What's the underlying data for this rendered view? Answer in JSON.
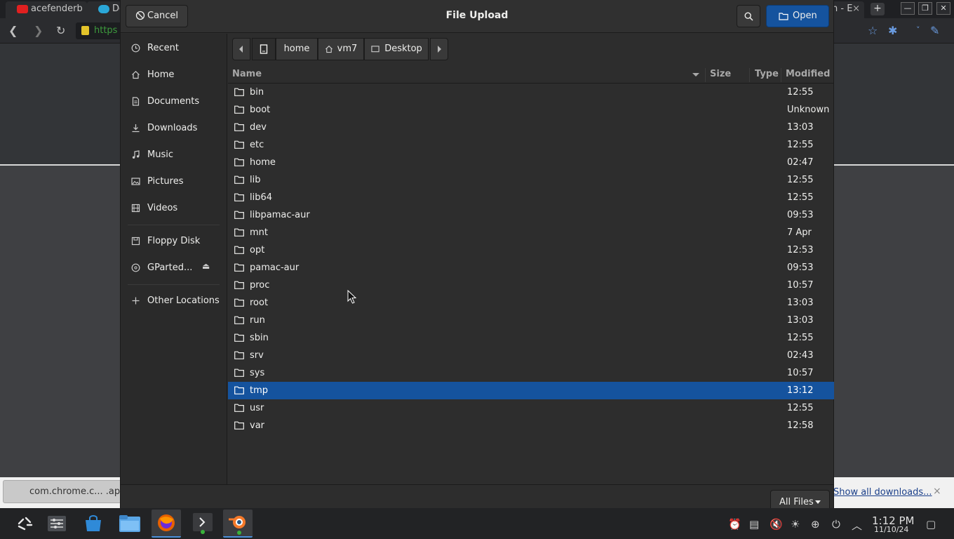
{
  "browser": {
    "tab1_label": "acefenderb",
    "tab2_label": "Dov",
    "tab3_label": "n - E",
    "tab3_close": "×",
    "new_tab": "+",
    "url_fragment": "https",
    "accent_tab_icon": "#e02020"
  },
  "downloads_bar": {
    "item_label": "com.chrome.c... .apk",
    "show_all": "Show all downloads...",
    "close": "×"
  },
  "dialog": {
    "title": "File Upload",
    "cancel_label": "Cancel",
    "open_label": "Open",
    "accent": "#15539e"
  },
  "sidebar": {
    "items": [
      {
        "label": "Recent",
        "icon": "clock-icon"
      },
      {
        "label": "Home",
        "icon": "home-icon"
      },
      {
        "label": "Documents",
        "icon": "document-icon"
      },
      {
        "label": "Downloads",
        "icon": "download-icon"
      },
      {
        "label": "Music",
        "icon": "music-icon"
      },
      {
        "label": "Pictures",
        "icon": "picture-icon"
      },
      {
        "label": "Videos",
        "icon": "video-icon"
      }
    ],
    "devices": [
      {
        "label": "Floppy Disk",
        "icon": "floppy-icon"
      },
      {
        "label": "GParted...",
        "icon": "disc-icon"
      }
    ],
    "other_locations": "Other Locations"
  },
  "pathbar": {
    "segments": [
      "home",
      "vm7",
      "Desktop"
    ]
  },
  "columns": {
    "name": "Name",
    "size": "Size",
    "type": "Type",
    "modified": "Modified"
  },
  "files": [
    {
      "name": "bin",
      "modified": "12:55"
    },
    {
      "name": "boot",
      "modified": "Unknown"
    },
    {
      "name": "dev",
      "modified": "13:03"
    },
    {
      "name": "etc",
      "modified": "12:55"
    },
    {
      "name": "home",
      "modified": "02:47"
    },
    {
      "name": "lib",
      "modified": "12:55"
    },
    {
      "name": "lib64",
      "modified": "12:55"
    },
    {
      "name": "libpamac-aur",
      "modified": "09:53"
    },
    {
      "name": "mnt",
      "modified": "7 Apr"
    },
    {
      "name": "opt",
      "modified": "12:53"
    },
    {
      "name": "pamac-aur",
      "modified": "09:53"
    },
    {
      "name": "proc",
      "modified": "10:57"
    },
    {
      "name": "root",
      "modified": "13:03"
    },
    {
      "name": "run",
      "modified": "13:03"
    },
    {
      "name": "sbin",
      "modified": "12:55"
    },
    {
      "name": "srv",
      "modified": "02:43"
    },
    {
      "name": "sys",
      "modified": "10:57"
    },
    {
      "name": "tmp",
      "modified": "13:12",
      "selected": true
    },
    {
      "name": "usr",
      "modified": "12:55"
    },
    {
      "name": "var",
      "modified": "12:58"
    }
  ],
  "filter": {
    "selected": "All Files"
  },
  "taskbar": {
    "clock_time": "1:12 PM",
    "clock_date": "11/10/24"
  }
}
